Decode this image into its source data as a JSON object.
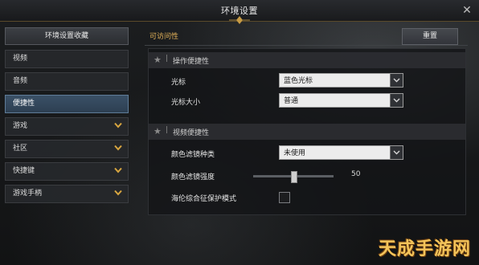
{
  "window": {
    "title": "环境设置",
    "close_glyph": "✕"
  },
  "sidebar": {
    "header": "环境设置收藏",
    "items": [
      {
        "label": "视频",
        "expandable": false,
        "active": false
      },
      {
        "label": "音频",
        "expandable": false,
        "active": false
      },
      {
        "label": "便捷性",
        "expandable": false,
        "active": true
      },
      {
        "label": "游戏",
        "expandable": true,
        "active": false
      },
      {
        "label": "社区",
        "expandable": true,
        "active": false
      },
      {
        "label": "快捷键",
        "expandable": true,
        "active": false
      },
      {
        "label": "游戏手柄",
        "expandable": true,
        "active": false
      }
    ]
  },
  "main": {
    "title": "可访问性",
    "reset_label": "重置",
    "sections": [
      {
        "label": "操作便捷性",
        "sep": "|",
        "rows": [
          {
            "label": "光标",
            "type": "dropdown",
            "value": "蓝色光标"
          },
          {
            "label": "光标大小",
            "type": "dropdown",
            "value": "普通"
          }
        ]
      },
      {
        "label": "视频便捷性",
        "sep": "|",
        "rows": [
          {
            "label": "颜色滤镜种类",
            "type": "dropdown",
            "value": "未使用"
          },
          {
            "label": "颜色滤镜强度",
            "type": "slider",
            "value": "50",
            "fraction": 0.5
          },
          {
            "label": "海伦综合征保护模式",
            "type": "checkbox",
            "checked": false
          }
        ]
      }
    ]
  },
  "watermark": {
    "text": "天成手游网"
  },
  "colors": {
    "accent_gold": "#e6b45a",
    "chevron_gold": "#d8a640",
    "active_blue": "#3a5066",
    "dropdown_bg": "#ececec"
  },
  "icons": {
    "star": "★",
    "chevron": "chevron-down-icon",
    "dropdown_arrow": "chevron-down-icon"
  }
}
